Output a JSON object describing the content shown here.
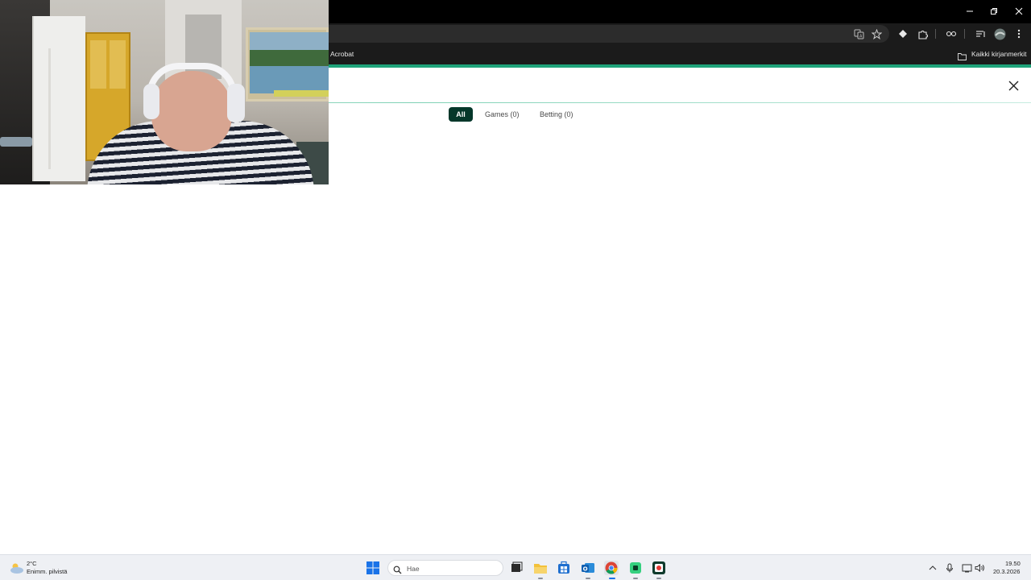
{
  "browser": {
    "bookmark_bar": {
      "left_bookmark": "Acrobat",
      "all_bookmarks": "Kaikki kirjanmerkit"
    }
  },
  "page": {
    "tabs": [
      {
        "label": "All",
        "active": true
      },
      {
        "label": "Games (0)",
        "active": false
      },
      {
        "label": "Betting (0)",
        "active": false
      }
    ],
    "close_icon": "close-icon"
  },
  "colors": {
    "accent": "#1fa37a",
    "active_tab": "#05372a"
  },
  "taskbar": {
    "weather": {
      "temp": "2°C",
      "desc": "Enimm. pilvistä"
    },
    "search_placeholder": "Hae",
    "clock": {
      "time": "19.50",
      "date": "20.3.2026"
    },
    "apps": [
      "start-icon",
      "search-icon",
      "task-view-icon",
      "file-explorer-icon",
      "store-icon",
      "outlook-icon",
      "chrome-icon",
      "app-icon",
      "media-icon"
    ]
  }
}
